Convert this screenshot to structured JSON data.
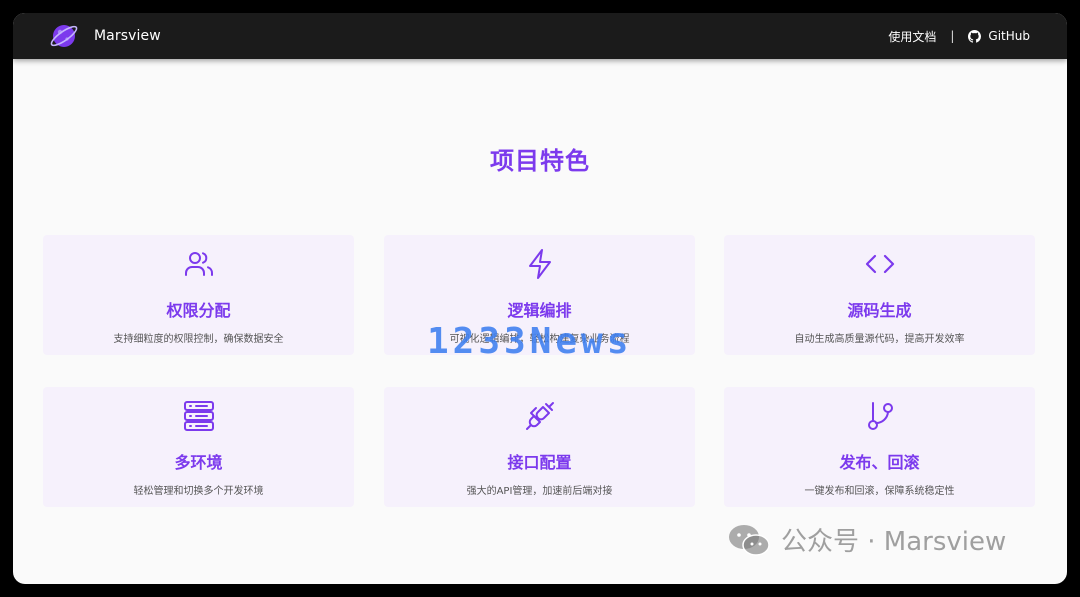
{
  "navbar": {
    "brand": "Marsview",
    "links": {
      "docs": "使用文档",
      "separator": "|",
      "github": "GitHub"
    },
    "icons": {
      "logo": "planet-logo-icon",
      "github": "github-icon"
    }
  },
  "features": {
    "title": "项目特色",
    "items": [
      {
        "icon": "users-icon",
        "title": "权限分配",
        "desc": "支持细粒度的权限控制，确保数据安全"
      },
      {
        "icon": "lightning-icon",
        "title": "逻辑编排",
        "desc": "可视化逻辑编排，轻松构建复杂业务流程"
      },
      {
        "icon": "code-icon",
        "title": "源码生成",
        "desc": "自动生成高质量源代码，提高开发效率"
      },
      {
        "icon": "server-icon",
        "title": "多环境",
        "desc": "轻松管理和切换多个开发环境"
      },
      {
        "icon": "plug-icon",
        "title": "接口配置",
        "desc": "强大的API管理，加速前后端对接"
      },
      {
        "icon": "git-branch-icon",
        "title": "发布、回滚",
        "desc": "一键发布和回滚，保障系统稳定性"
      }
    ]
  },
  "overlays": {
    "watermark": "1233News",
    "wechat_label": "公众号 · Marsview"
  },
  "colors": {
    "accent": "#7c3aed",
    "navbar": "#1b1b1b",
    "card": "#f6f1fc",
    "page": "#fafafa"
  }
}
